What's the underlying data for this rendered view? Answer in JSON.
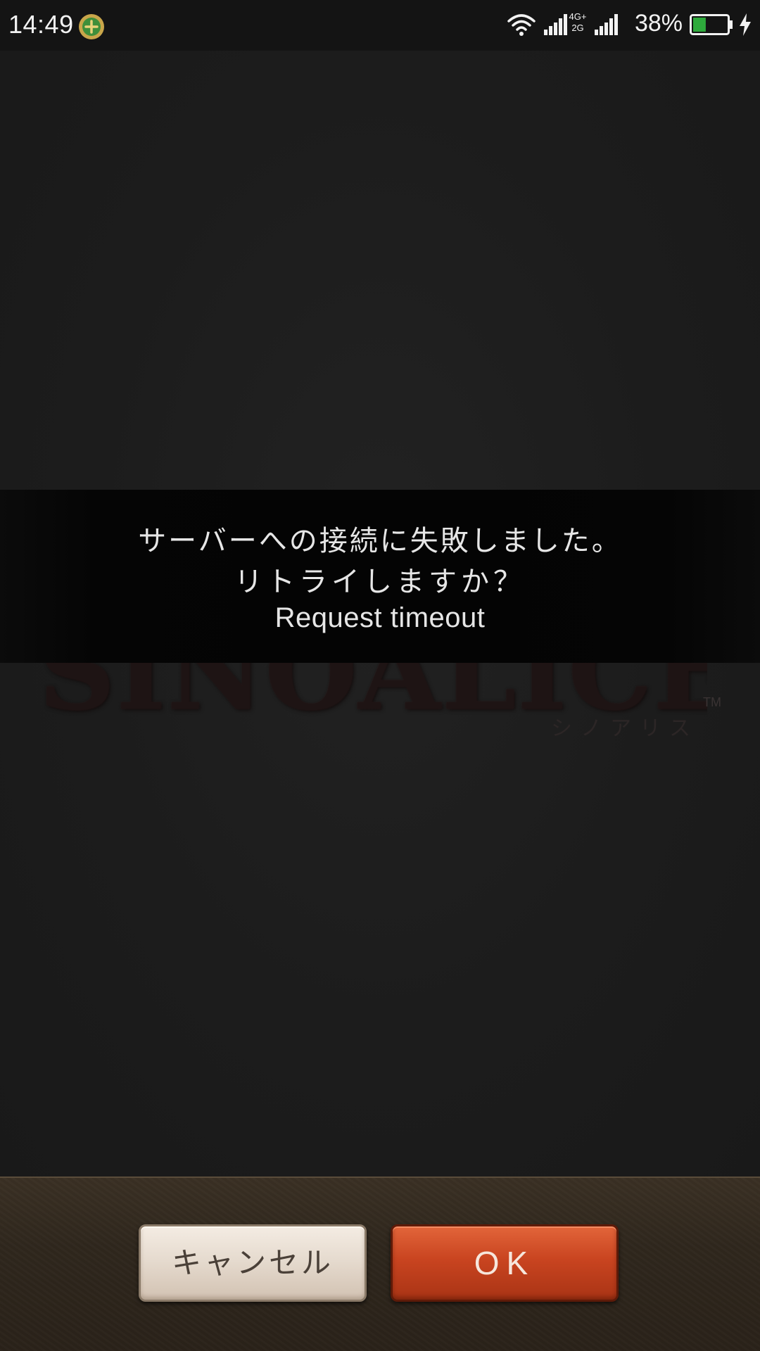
{
  "status_bar": {
    "time": "14:49",
    "network_top": "4G+",
    "network_bottom": "2G",
    "battery_percent": "38%",
    "battery_level": 0.38,
    "icons": [
      "app-notification-icon",
      "wifi-icon",
      "signal-icon",
      "signal-icon",
      "battery-icon",
      "charging-icon"
    ]
  },
  "logo": {
    "title": "SINOALICE",
    "trademark": "TM",
    "subtitle": "シノアリス"
  },
  "dialog": {
    "message_line1": "サーバーへの接続に失敗しました。",
    "message_line2": "リトライしますか？",
    "error_detail": "Request timeout"
  },
  "buttons": {
    "cancel_label": "キャンセル",
    "ok_label": "OK"
  },
  "colors": {
    "ok_button": "#c94420",
    "cancel_button": "#e6dbcf",
    "banner": "#040404",
    "battery_fill": "#2eaa3c"
  }
}
